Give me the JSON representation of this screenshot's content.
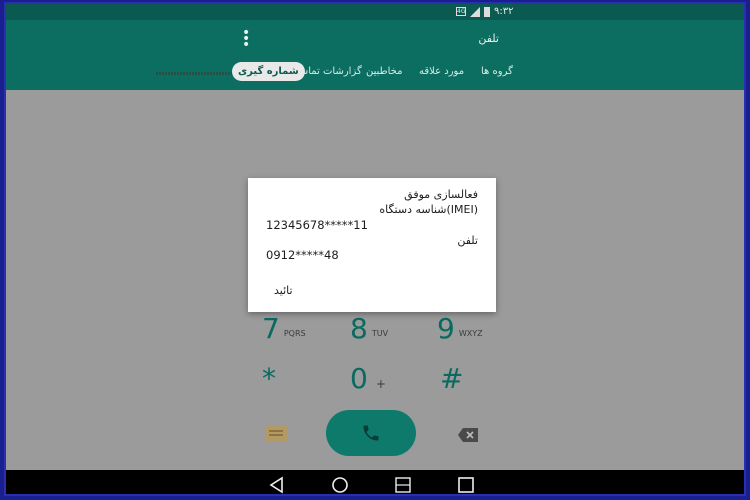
{
  "status_bar": {
    "time": "۹:۳۲",
    "sim_label": "4G"
  },
  "app_bar": {
    "title": "تلفن",
    "tabs": [
      {
        "label": "گروه ها"
      },
      {
        "label": "مورد علاقه"
      },
      {
        "label": "مخاطبین"
      },
      {
        "label": "گزارشات تماس"
      },
      {
        "label": "شماره گیری",
        "active": true
      }
    ]
  },
  "dialpad": {
    "keys": [
      {
        "digit": "7",
        "letters": "PQRS"
      },
      {
        "digit": "8",
        "letters": "TUV"
      },
      {
        "digit": "9",
        "letters": "WXYZ"
      },
      {
        "digit": "*",
        "letters": ""
      },
      {
        "digit": "0",
        "letters": "+"
      },
      {
        "digit": "#",
        "letters": ""
      }
    ]
  },
  "dialog": {
    "title": "فعالسازی موفق",
    "imei_label": "شناسه دستگاه(IMEI)",
    "imei_value": "12345678*****11",
    "phone_label": "تلفن",
    "phone_value": "0912*****48",
    "ok_label": "تائید"
  },
  "colors": {
    "app_bar": "#0c6d61",
    "status_bar": "#0b5a52",
    "accent": "#0b6a5f",
    "dim_background": "#9b9b9b"
  }
}
